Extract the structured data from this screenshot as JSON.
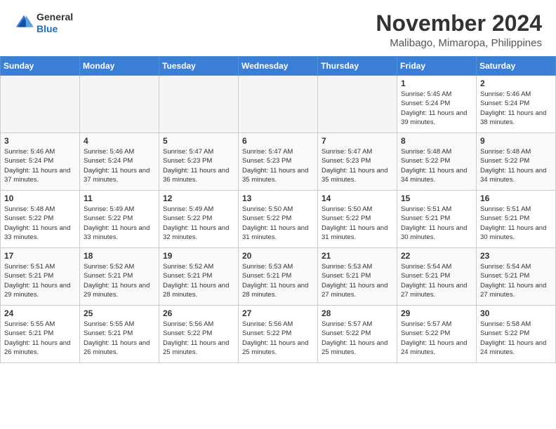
{
  "header": {
    "logo_general": "General",
    "logo_blue": "Blue",
    "month_year": "November 2024",
    "location": "Malibago, Mimaropa, Philippines"
  },
  "weekdays": [
    "Sunday",
    "Monday",
    "Tuesday",
    "Wednesday",
    "Thursday",
    "Friday",
    "Saturday"
  ],
  "weeks": [
    [
      {
        "day": "",
        "sunrise": "",
        "sunset": "",
        "daylight": "",
        "empty": true
      },
      {
        "day": "",
        "sunrise": "",
        "sunset": "",
        "daylight": "",
        "empty": true
      },
      {
        "day": "",
        "sunrise": "",
        "sunset": "",
        "daylight": "",
        "empty": true
      },
      {
        "day": "",
        "sunrise": "",
        "sunset": "",
        "daylight": "",
        "empty": true
      },
      {
        "day": "",
        "sunrise": "",
        "sunset": "",
        "daylight": "",
        "empty": true
      },
      {
        "day": "1",
        "sunrise": "Sunrise: 5:45 AM",
        "sunset": "Sunset: 5:24 PM",
        "daylight": "Daylight: 11 hours and 39 minutes.",
        "empty": false
      },
      {
        "day": "2",
        "sunrise": "Sunrise: 5:46 AM",
        "sunset": "Sunset: 5:24 PM",
        "daylight": "Daylight: 11 hours and 38 minutes.",
        "empty": false
      }
    ],
    [
      {
        "day": "3",
        "sunrise": "Sunrise: 5:46 AM",
        "sunset": "Sunset: 5:24 PM",
        "daylight": "Daylight: 11 hours and 37 minutes.",
        "empty": false
      },
      {
        "day": "4",
        "sunrise": "Sunrise: 5:46 AM",
        "sunset": "Sunset: 5:24 PM",
        "daylight": "Daylight: 11 hours and 37 minutes.",
        "empty": false
      },
      {
        "day": "5",
        "sunrise": "Sunrise: 5:47 AM",
        "sunset": "Sunset: 5:23 PM",
        "daylight": "Daylight: 11 hours and 36 minutes.",
        "empty": false
      },
      {
        "day": "6",
        "sunrise": "Sunrise: 5:47 AM",
        "sunset": "Sunset: 5:23 PM",
        "daylight": "Daylight: 11 hours and 35 minutes.",
        "empty": false
      },
      {
        "day": "7",
        "sunrise": "Sunrise: 5:47 AM",
        "sunset": "Sunset: 5:23 PM",
        "daylight": "Daylight: 11 hours and 35 minutes.",
        "empty": false
      },
      {
        "day": "8",
        "sunrise": "Sunrise: 5:48 AM",
        "sunset": "Sunset: 5:22 PM",
        "daylight": "Daylight: 11 hours and 34 minutes.",
        "empty": false
      },
      {
        "day": "9",
        "sunrise": "Sunrise: 5:48 AM",
        "sunset": "Sunset: 5:22 PM",
        "daylight": "Daylight: 11 hours and 34 minutes.",
        "empty": false
      }
    ],
    [
      {
        "day": "10",
        "sunrise": "Sunrise: 5:48 AM",
        "sunset": "Sunset: 5:22 PM",
        "daylight": "Daylight: 11 hours and 33 minutes.",
        "empty": false
      },
      {
        "day": "11",
        "sunrise": "Sunrise: 5:49 AM",
        "sunset": "Sunset: 5:22 PM",
        "daylight": "Daylight: 11 hours and 33 minutes.",
        "empty": false
      },
      {
        "day": "12",
        "sunrise": "Sunrise: 5:49 AM",
        "sunset": "Sunset: 5:22 PM",
        "daylight": "Daylight: 11 hours and 32 minutes.",
        "empty": false
      },
      {
        "day": "13",
        "sunrise": "Sunrise: 5:50 AM",
        "sunset": "Sunset: 5:22 PM",
        "daylight": "Daylight: 11 hours and 31 minutes.",
        "empty": false
      },
      {
        "day": "14",
        "sunrise": "Sunrise: 5:50 AM",
        "sunset": "Sunset: 5:22 PM",
        "daylight": "Daylight: 11 hours and 31 minutes.",
        "empty": false
      },
      {
        "day": "15",
        "sunrise": "Sunrise: 5:51 AM",
        "sunset": "Sunset: 5:21 PM",
        "daylight": "Daylight: 11 hours and 30 minutes.",
        "empty": false
      },
      {
        "day": "16",
        "sunrise": "Sunrise: 5:51 AM",
        "sunset": "Sunset: 5:21 PM",
        "daylight": "Daylight: 11 hours and 30 minutes.",
        "empty": false
      }
    ],
    [
      {
        "day": "17",
        "sunrise": "Sunrise: 5:51 AM",
        "sunset": "Sunset: 5:21 PM",
        "daylight": "Daylight: 11 hours and 29 minutes.",
        "empty": false
      },
      {
        "day": "18",
        "sunrise": "Sunrise: 5:52 AM",
        "sunset": "Sunset: 5:21 PM",
        "daylight": "Daylight: 11 hours and 29 minutes.",
        "empty": false
      },
      {
        "day": "19",
        "sunrise": "Sunrise: 5:52 AM",
        "sunset": "Sunset: 5:21 PM",
        "daylight": "Daylight: 11 hours and 28 minutes.",
        "empty": false
      },
      {
        "day": "20",
        "sunrise": "Sunrise: 5:53 AM",
        "sunset": "Sunset: 5:21 PM",
        "daylight": "Daylight: 11 hours and 28 minutes.",
        "empty": false
      },
      {
        "day": "21",
        "sunrise": "Sunrise: 5:53 AM",
        "sunset": "Sunset: 5:21 PM",
        "daylight": "Daylight: 11 hours and 27 minutes.",
        "empty": false
      },
      {
        "day": "22",
        "sunrise": "Sunrise: 5:54 AM",
        "sunset": "Sunset: 5:21 PM",
        "daylight": "Daylight: 11 hours and 27 minutes.",
        "empty": false
      },
      {
        "day": "23",
        "sunrise": "Sunrise: 5:54 AM",
        "sunset": "Sunset: 5:21 PM",
        "daylight": "Daylight: 11 hours and 27 minutes.",
        "empty": false
      }
    ],
    [
      {
        "day": "24",
        "sunrise": "Sunrise: 5:55 AM",
        "sunset": "Sunset: 5:21 PM",
        "daylight": "Daylight: 11 hours and 26 minutes.",
        "empty": false
      },
      {
        "day": "25",
        "sunrise": "Sunrise: 5:55 AM",
        "sunset": "Sunset: 5:21 PM",
        "daylight": "Daylight: 11 hours and 26 minutes.",
        "empty": false
      },
      {
        "day": "26",
        "sunrise": "Sunrise: 5:56 AM",
        "sunset": "Sunset: 5:22 PM",
        "daylight": "Daylight: 11 hours and 25 minutes.",
        "empty": false
      },
      {
        "day": "27",
        "sunrise": "Sunrise: 5:56 AM",
        "sunset": "Sunset: 5:22 PM",
        "daylight": "Daylight: 11 hours and 25 minutes.",
        "empty": false
      },
      {
        "day": "28",
        "sunrise": "Sunrise: 5:57 AM",
        "sunset": "Sunset: 5:22 PM",
        "daylight": "Daylight: 11 hours and 25 minutes.",
        "empty": false
      },
      {
        "day": "29",
        "sunrise": "Sunrise: 5:57 AM",
        "sunset": "Sunset: 5:22 PM",
        "daylight": "Daylight: 11 hours and 24 minutes.",
        "empty": false
      },
      {
        "day": "30",
        "sunrise": "Sunrise: 5:58 AM",
        "sunset": "Sunset: 5:22 PM",
        "daylight": "Daylight: 11 hours and 24 minutes.",
        "empty": false
      }
    ]
  ]
}
